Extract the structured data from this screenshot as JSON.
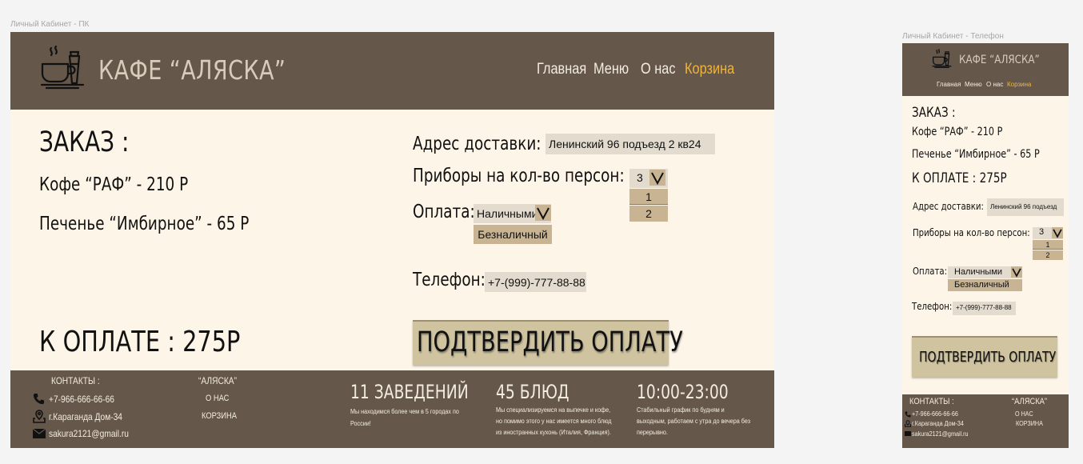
{
  "frames": {
    "pc_label": "Личный Кабинет - ПК",
    "phone_label": "Личный Кабинет - Телефон"
  },
  "brand": {
    "name": "КАФЕ “АЛЯСКА”"
  },
  "nav": [
    {
      "label": "Главная"
    },
    {
      "label": "Меню"
    },
    {
      "label": "О нас"
    },
    {
      "label": "Корзина",
      "active": true
    }
  ],
  "order": {
    "title": "ЗАКАЗ :",
    "items": [
      {
        "label": "Кофе “РАФ” - 210 Р"
      },
      {
        "label": "Печенье “Имбирное” - 65 Р"
      }
    ],
    "total_desktop": "К ОПЛАТЕ : 275Р",
    "total_phone": "К ОПЛАТЕ : 275Р"
  },
  "form": {
    "address_label": "Адрес доставки:",
    "address_value": "Ленинский 96 подъезд 2 кв24",
    "address_value_phone": "Ленинский 96 подъезд",
    "persons_label": "Приборы на кол-во персон:",
    "persons_value": "3",
    "persons_options": [
      "1",
      "2"
    ],
    "payment_label": "Оплата:",
    "payment_value": "Наличными",
    "payment_options": [
      "Безналичный"
    ],
    "phone_label": "Телефон:",
    "phone_value": "+7-(999)-777-88-88",
    "confirm": "ПОДТВЕРДИТЬ ОПЛАТУ"
  },
  "footer": {
    "contacts_title": "КОНТАКТЫ :",
    "contacts_title_phone": "КОНТАКТЫ :",
    "phone": "+7-966-666-66-66",
    "address": "г.Караганда Дом-34",
    "email": "sakura2121@gmail.ru",
    "brand_title": "“АЛЯСКА”",
    "links": [
      "О НАС",
      "КОРЗИНА"
    ],
    "stats": [
      {
        "title": "11 ЗАВЕДЕНИЙ",
        "text1": "Мы находимся более чем в 5 городах по",
        "text2": "России!",
        "text3": ""
      },
      {
        "title": "45 БЛЮД",
        "text1": "Мы специализируемся на выпечке и кофе,",
        "text2": "но помимо этого у нас имеется много блюд",
        "text3": "из иностранных кухонь (Италия, Франция)."
      },
      {
        "title": "10:00-23:00",
        "text1": "Стабильный график по будням и",
        "text2": "выходным, работаем с утра до вечера без",
        "text3": "перерывно."
      }
    ]
  },
  "colors": {
    "header_bg": "#65574a",
    "page_bg": "#fdf5e7",
    "accent": "#f0b43c",
    "field_bg": "#e3dbce",
    "option_bg": "#c8b493",
    "button_bg": "#cfc3a0"
  },
  "icons": {
    "logo": "coffee-cup-logo-icon",
    "dropdown": "chevron-down-icon",
    "phone": "phone-icon",
    "location": "location-pin-icon",
    "email": "envelope-icon"
  }
}
